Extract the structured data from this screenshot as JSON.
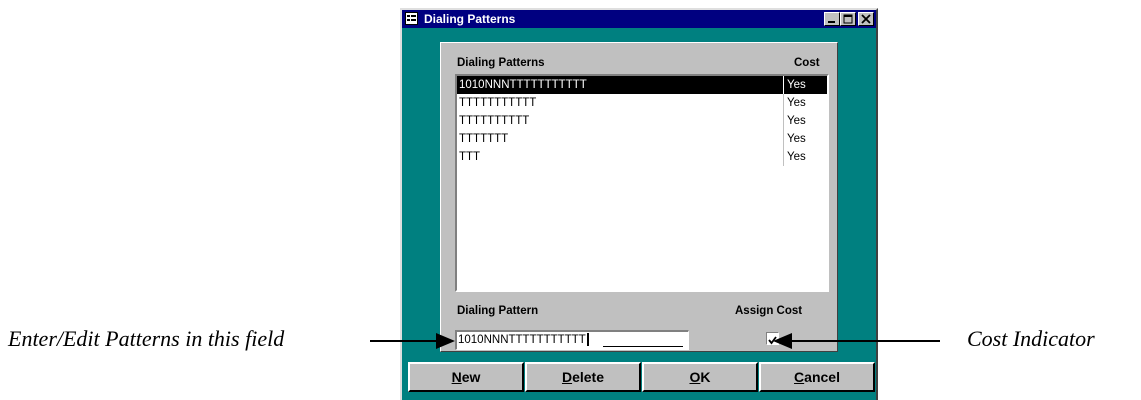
{
  "window": {
    "title": "Dialing Patterns"
  },
  "list": {
    "header_pattern": "Dialing Patterns",
    "header_cost": "Cost",
    "rows": [
      {
        "pattern": "1010NNNTTTTTTTTTTT",
        "cost": "Yes",
        "selected": true
      },
      {
        "pattern": "TTTTTTTTTTT",
        "cost": "Yes"
      },
      {
        "pattern": "TTTTTTTTTT",
        "cost": "Yes"
      },
      {
        "pattern": "TTTTTTT",
        "cost": "Yes"
      },
      {
        "pattern": "TTT",
        "cost": "Yes"
      }
    ]
  },
  "editor": {
    "pattern_label": "Dialing Pattern",
    "pattern_value": "1010NNNTTTTTTTTTTT",
    "assign_cost_label": "Assign Cost",
    "assign_cost_checked": true
  },
  "buttons": {
    "new_hotkey": "N",
    "new_rest": "ew",
    "delete_hotkey": "D",
    "delete_rest": "elete",
    "ok_hotkey": "O",
    "ok_rest": "K",
    "cancel_hotkey": "C",
    "cancel_rest": "ancel"
  },
  "annotations": {
    "left": "Enter/Edit Patterns in this field",
    "right": "Cost Indicator"
  },
  "colors": {
    "title_bar": "#000080",
    "window_bg": "#008080",
    "form_bg": "#c0c0c0",
    "selection": "#000000"
  }
}
